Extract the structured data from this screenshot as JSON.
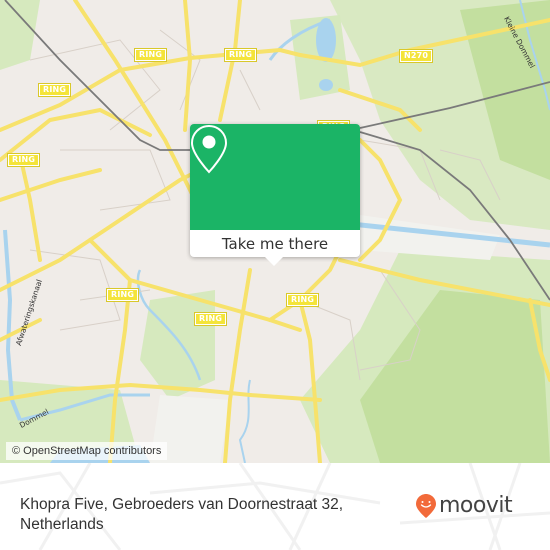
{
  "map": {
    "road_labels": [
      "RING",
      "RING",
      "RING",
      "RING",
      "RING",
      "RING",
      "RING",
      "RING",
      "N270"
    ],
    "water_labels": [
      "Kleine Dommel",
      "Afwateringskanaal",
      "Dommel"
    ],
    "attribution": "© OpenStreetMap contributors",
    "colors": {
      "land": "#f0ece8",
      "park": "#cfe6b0",
      "water": "#a9d3ee",
      "road": "#f7e26b",
      "rail": "#777777"
    }
  },
  "popup": {
    "icon": "location-pin-icon",
    "button_label": "Take me there",
    "color": "#1bb466"
  },
  "footer": {
    "address_line1": "Khopra Five, Gebroeders van Doornestraat 32,",
    "address_line2": "Netherlands",
    "logo_text": "moovit",
    "logo_color": "#f26a3a"
  }
}
